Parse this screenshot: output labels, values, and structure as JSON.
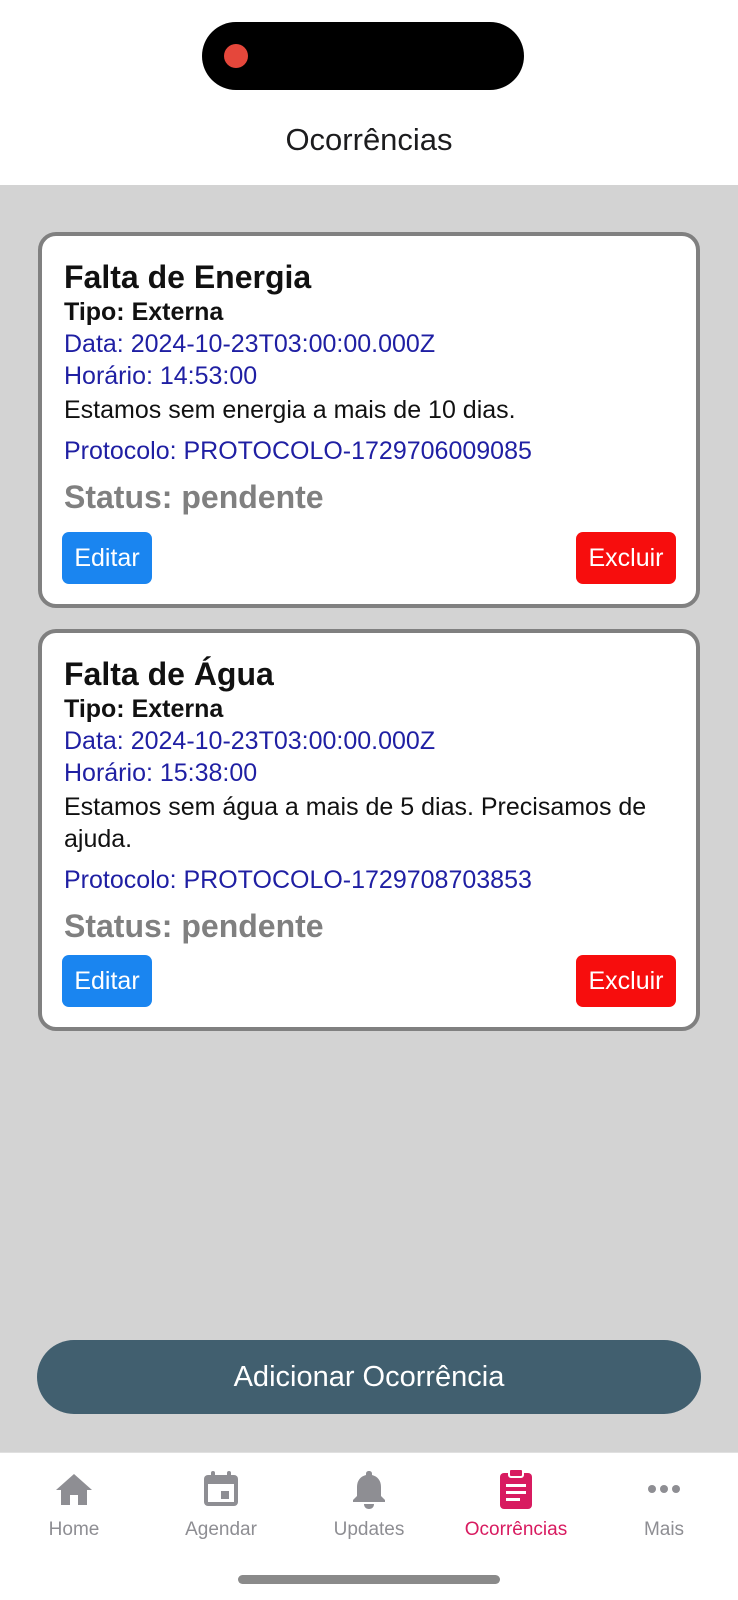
{
  "header": {
    "title": "Ocorrências"
  },
  "occurrences": [
    {
      "title": "Falta de Energia",
      "type": "Tipo: Externa",
      "date": "Data: 2024-10-23T03:00:00.000Z",
      "time": "Horário: 14:53:00",
      "description": "Estamos sem energia a mais de 10 dias.",
      "protocol": "Protocolo: PROTOCOLO-1729706009085",
      "status": "Status: pendente",
      "edit_label": "Editar",
      "delete_label": "Excluir"
    },
    {
      "title": "Falta de Água",
      "type": "Tipo: Externa",
      "date": "Data: 2024-10-23T03:00:00.000Z",
      "time": "Horário: 15:38:00",
      "description": "Estamos sem água a mais de 5 dias. Precisamos de ajuda.",
      "protocol": "Protocolo: PROTOCOLO-1729708703853",
      "status": "Status: pendente",
      "edit_label": "Editar",
      "delete_label": "Excluir"
    }
  ],
  "add_button": {
    "label": "Adicionar Ocorrência"
  },
  "tabbar": {
    "active_color": "#d81b60",
    "inactive_color": "#8e8e93",
    "items": [
      {
        "label": "Home",
        "icon": "home-icon"
      },
      {
        "label": "Agendar",
        "icon": "calendar-icon"
      },
      {
        "label": "Updates",
        "icon": "bell-icon"
      },
      {
        "label": "Ocorrências",
        "icon": "clipboard-icon",
        "active": true
      },
      {
        "label": "Mais",
        "icon": "more-icon"
      }
    ]
  },
  "colors": {
    "edit_button": "#1a85f0",
    "delete_button": "#f70d0d",
    "add_button": "#415f6f",
    "content_background": "#d3d3d3"
  }
}
